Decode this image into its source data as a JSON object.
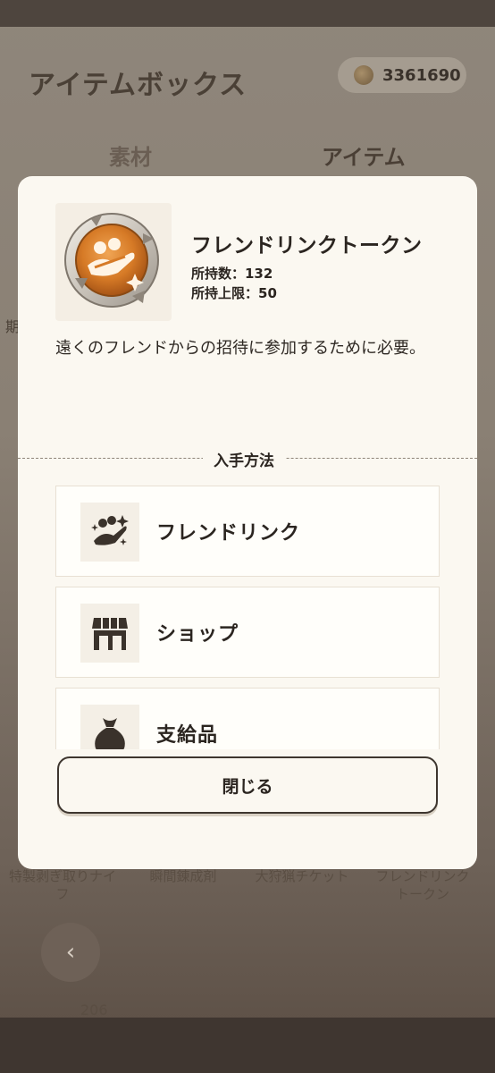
{
  "background": {
    "title": "アイテムボックス",
    "coins": "3361690",
    "tabs": [
      "素材",
      "アイテム"
    ],
    "side_glyph": "期",
    "item_labels": [
      "特製剥ぎ取りナイフ",
      "瞬間錬成剤",
      "大狩猟チケット",
      "フレンドリンクトークン"
    ],
    "item_count": "206",
    "back_label": "‹"
  },
  "modal": {
    "item_name": "フレンドリンクトークン",
    "count_text": "所持数：132",
    "limit_text": "所持上限：50",
    "description": "遠くのフレンドからの招待に参加するために必要。",
    "section_title": "入手方法",
    "sources": [
      {
        "label": "フレンドリンク",
        "icon": "friend-link-icon"
      },
      {
        "label": "ショップ",
        "icon": "shop-icon"
      },
      {
        "label": "支給品",
        "icon": "supply-bag-icon"
      }
    ],
    "close_label": "閉じる"
  }
}
